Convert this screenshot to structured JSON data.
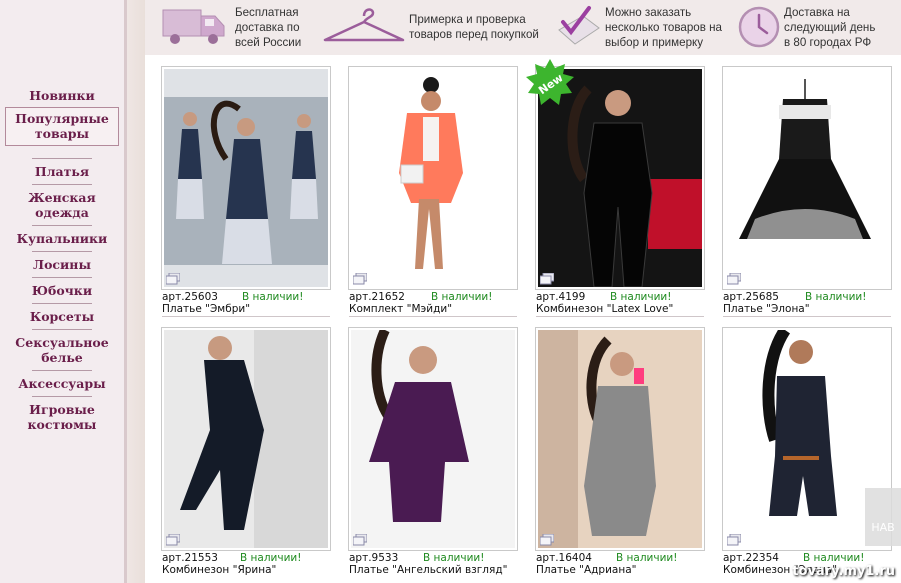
{
  "nav": {
    "items": [
      "Новинки",
      "Популярные товары",
      "Платья",
      "Женская одежда",
      "Купальники",
      "Лосины",
      "Юбочки",
      "Корсеты",
      "Сексуальное белье",
      "Аксессуары",
      "Игровые костюмы"
    ],
    "active_index": 1,
    "lines": [
      [
        "Новинки"
      ],
      [
        "Популярные",
        "товары"
      ],
      [
        "Платья"
      ],
      [
        "Женская",
        "одежда"
      ],
      [
        "Купальники"
      ],
      [
        "Лосины"
      ],
      [
        "Юбочки"
      ],
      [
        "Корсеты"
      ],
      [
        "Сексуальное",
        "белье"
      ],
      [
        "Аксессуары"
      ],
      [
        "Игровые",
        "костюмы"
      ]
    ]
  },
  "features": [
    {
      "icon": "truck-icon",
      "lines": [
        "Бесплатная",
        "доставка по",
        "всей  России"
      ]
    },
    {
      "icon": "hanger-icon",
      "lines": [
        "Примерка и проверка",
        "товаров перед покупкой"
      ]
    },
    {
      "icon": "checkbox-icon",
      "lines": [
        "Можно заказать",
        "несколько товаров на",
        "выбор и примерку"
      ]
    },
    {
      "icon": "clock-icon",
      "lines": [
        "Доставка на",
        "следующий день",
        "в 80 городах РФ"
      ]
    }
  ],
  "products": [
    {
      "art": "арт.25603",
      "stock": "В наличии!",
      "name": "Платье \"Эмбри\"",
      "new": false
    },
    {
      "art": "арт.21652",
      "stock": "В наличии!",
      "name": "Комплект \"Мэйди\"",
      "new": false
    },
    {
      "art": "арт.4199",
      "stock": "В наличии!",
      "name": "Комбинезон \"Latex Love\"",
      "new": true
    },
    {
      "art": "арт.25685",
      "stock": "В наличии!",
      "name": "Платье \"Элона\"",
      "new": false
    },
    {
      "art": "арт.21553",
      "stock": "В наличии!",
      "name": "Комбинезон \"Ярина\"",
      "new": false
    },
    {
      "art": "арт.9533",
      "stock": "В наличии!",
      "name": "Платье \"Ангельский взгляд\"",
      "new": false
    },
    {
      "art": "арт.16404",
      "stock": "В наличии!",
      "name": "Платье \"Адриана\"",
      "new": false
    },
    {
      "art": "арт.22354",
      "stock": "В наличии!",
      "name": "Комбинезон \"Элона\"",
      "new": false
    }
  ],
  "badges": {
    "new_label": "New"
  },
  "watermark": "tovary.my1.ru",
  "side_tab": "НАВ",
  "colors": {
    "nav_text": "#6a1e4a",
    "stock_text": "#1f8a1f",
    "accent_purple": "#9b5d9b"
  }
}
